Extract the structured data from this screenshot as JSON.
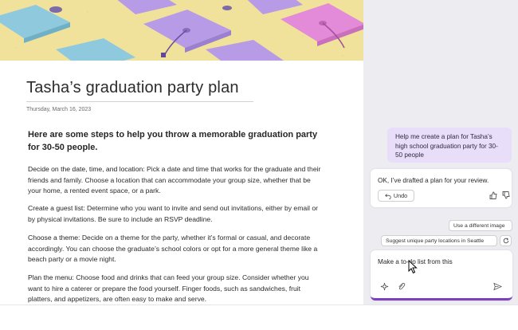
{
  "document": {
    "title": "Tasha’s graduation party plan",
    "date": "Thursday, March 16, 2023",
    "heading": "Here are some steps to help you throw a memorable graduation party for 30-50 people.",
    "paragraphs": [
      {
        "lead": "Decide on the date, time, and location:",
        "body": " Pick a date and time that works for the graduate and their friends and family. Choose a location that can accommodate your group size, whether that be your home, a rented event space, or a park."
      },
      {
        "lead": "Create a guest list:",
        "body": " Determine who you want to invite and send out invitations, either by email or by physical invitations. Be sure to include an RSVP deadline."
      },
      {
        "lead": "Choose a theme:",
        "body": " Decide on a theme for the party, whether it’s formal or casual, and decorate accordingly. You can choose the graduate’s school colors or opt for a more general theme like a beach party or a movie night."
      },
      {
        "lead": "Plan the menu:",
        "body": " Choose food and drinks that can feed your group size. Consider whether you want to hire a caterer or prepare the food yourself. Finger foods, such as sandwiches, fruit platters, and appetizers, are often easy to make and serve."
      }
    ]
  },
  "copilot": {
    "user_message": "Help me create a plan for Tasha’s high school graduation party for 30-50 people",
    "bot_message": "OK, I’ve drafted a plan for your review.",
    "undo_label": "Undo",
    "suggestions": [
      "Use a different image",
      "Suggest unique party locations in Seattle"
    ],
    "compose_value": "Make a to-do list from this"
  },
  "colors": {
    "banner_bg": "#f0e29b",
    "cap_blue": "#8ec9de",
    "cap_purple": "#b79be6",
    "cap_pink": "#e38ad8",
    "accent": "#7b3fbf",
    "user_bubble": "#e8def9"
  },
  "icons": {
    "undo": "undo-icon",
    "like": "thumbs-up-icon",
    "dislike": "thumbs-down-icon",
    "refresh": "refresh-icon",
    "sparkle": "sparkle-icon",
    "attach": "paperclip-icon",
    "send": "send-icon"
  }
}
